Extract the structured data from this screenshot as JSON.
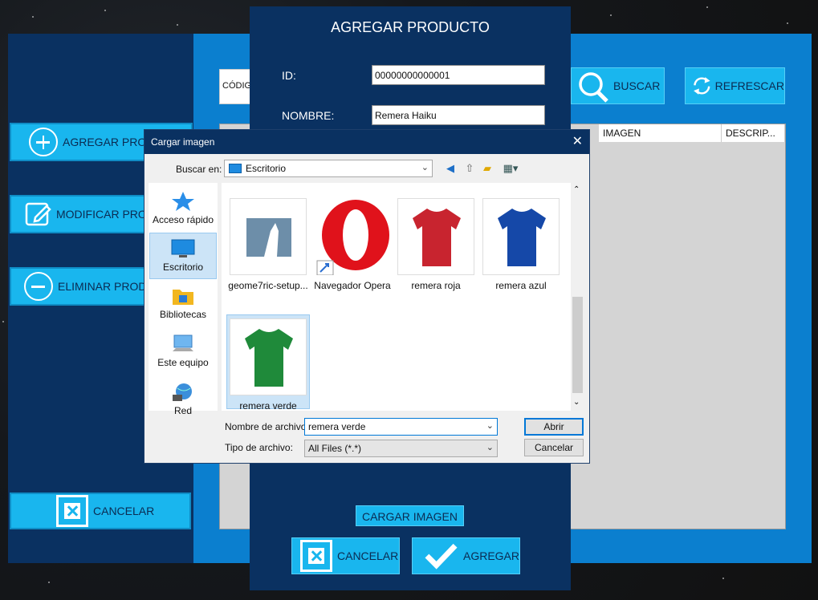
{
  "main_window": {
    "side_buttons": [
      {
        "label": "AGREGAR PROD",
        "icon": "plus-circle-icon"
      },
      {
        "label": "MODIFICAR PRO",
        "icon": "edit-icon"
      },
      {
        "label": "ELIMINAR PROD",
        "icon": "minus-circle-icon"
      }
    ],
    "cancel_label": "CANCELAR",
    "search_prefix": "CÓDIG",
    "buscar_label": "BUSCAR",
    "refrescar_label": "REFRESCAR",
    "table_columns": [
      "IMAGEN",
      "DESCRIP..."
    ]
  },
  "agregar_dialog": {
    "title": "AGREGAR PRODUCTO",
    "id_label": "ID:",
    "id_value": "00000000000001",
    "nombre_label": "NOMBRE:",
    "nombre_value": "Remera Haiku",
    "cargar_imagen_label": "CARGAR IMAGEN",
    "cancelar_label": "CANCELAR",
    "agregar_label": "AGREGAR"
  },
  "file_dialog": {
    "title": "Cargar imagen",
    "close": "✕",
    "look_in_label": "Buscar en:",
    "look_in_value": "Escritorio",
    "places": [
      {
        "label": "Acceso rápido",
        "icon": "star-icon"
      },
      {
        "label": "Escritorio",
        "icon": "desktop-icon",
        "selected": true
      },
      {
        "label": "Bibliotecas",
        "icon": "folder-icon"
      },
      {
        "label": "Este equipo",
        "icon": "computer-icon"
      },
      {
        "label": "Red",
        "icon": "network-icon"
      }
    ],
    "files": [
      {
        "name": "geome7ric-setup...",
        "kind": "image"
      },
      {
        "name": "Navegador Opera",
        "kind": "shortcut"
      },
      {
        "name": "remera roja",
        "kind": "image"
      },
      {
        "name": "remera azul",
        "kind": "image"
      },
      {
        "name": "remera verde",
        "kind": "image",
        "selected": true
      }
    ],
    "filename_label": "Nombre de archivo:",
    "filename_value": "remera verde",
    "filetype_label": "Tipo de archivo:",
    "filetype_value": "All Files (*.*)",
    "open_label": "Abrir",
    "cancel_label": "Cancelar"
  },
  "colors": {
    "navy": "#0a3161",
    "accent_blue": "#19b6ee",
    "tshirt_red": "#c8242f",
    "tshirt_blue": "#1548a8",
    "tshirt_green": "#1f8a3a"
  }
}
